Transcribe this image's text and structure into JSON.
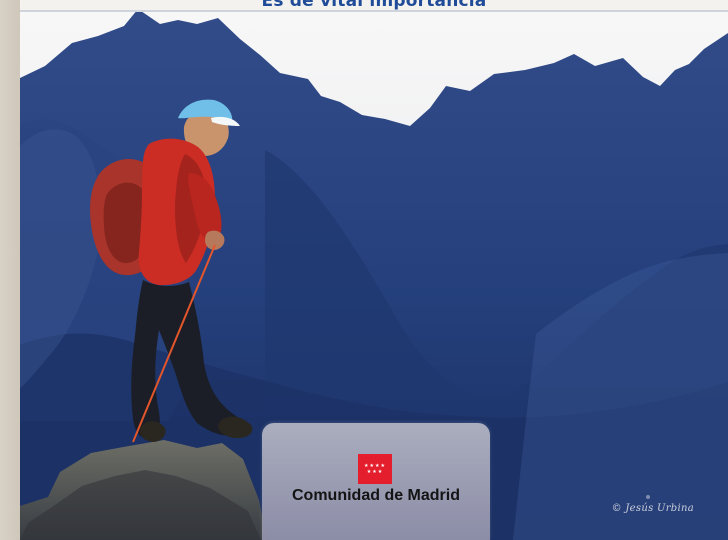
{
  "header": {
    "text": "Es de vital importancia"
  },
  "logo": {
    "name": "Comunidad de Madrid",
    "flag_color": "#e41e2d"
  },
  "photo": {
    "copyright": "© Jesús Urbina"
  },
  "colors": {
    "header_text": "#1f4b98",
    "sky": "#f2f2f2",
    "mountains": "#23386d"
  }
}
